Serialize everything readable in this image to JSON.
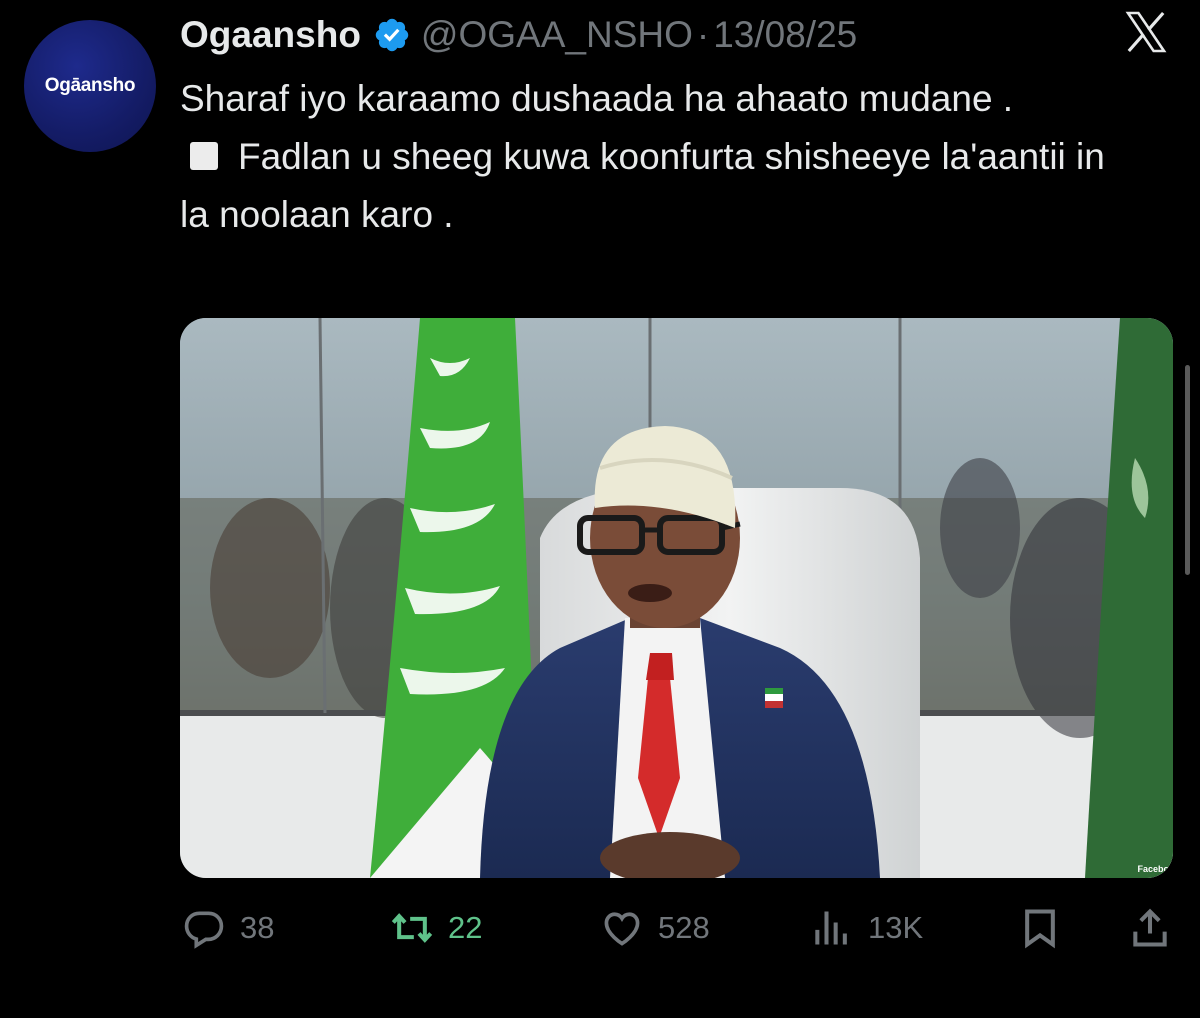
{
  "tweet": {
    "avatar_text": "Ogāansho",
    "author_name": "Ogaansho",
    "handle": "@OGAA_NSHO",
    "separator": "·",
    "date": "13/08/25",
    "text_line1": "Sharaf iyo karaamo dushaada ha ahaato mudane .",
    "text_line2": "Fadlan u sheeg kuwa koonfurta shisheeye la'aantii in la noolaan karo .",
    "photo_credit": "Facebo"
  },
  "actions": {
    "replies": "38",
    "reposts": "22",
    "likes": "528",
    "views": "13K"
  },
  "colors": {
    "background": "#000000",
    "text": "#e7e9ea",
    "muted": "#71767b",
    "repost_active": "#5fc28a",
    "verified": "#1d9bf0"
  },
  "icons": [
    "verified-badge-icon",
    "x-logo-icon",
    "reply-icon",
    "repost-icon",
    "like-icon",
    "views-icon",
    "bookmark-icon",
    "share-icon"
  ]
}
